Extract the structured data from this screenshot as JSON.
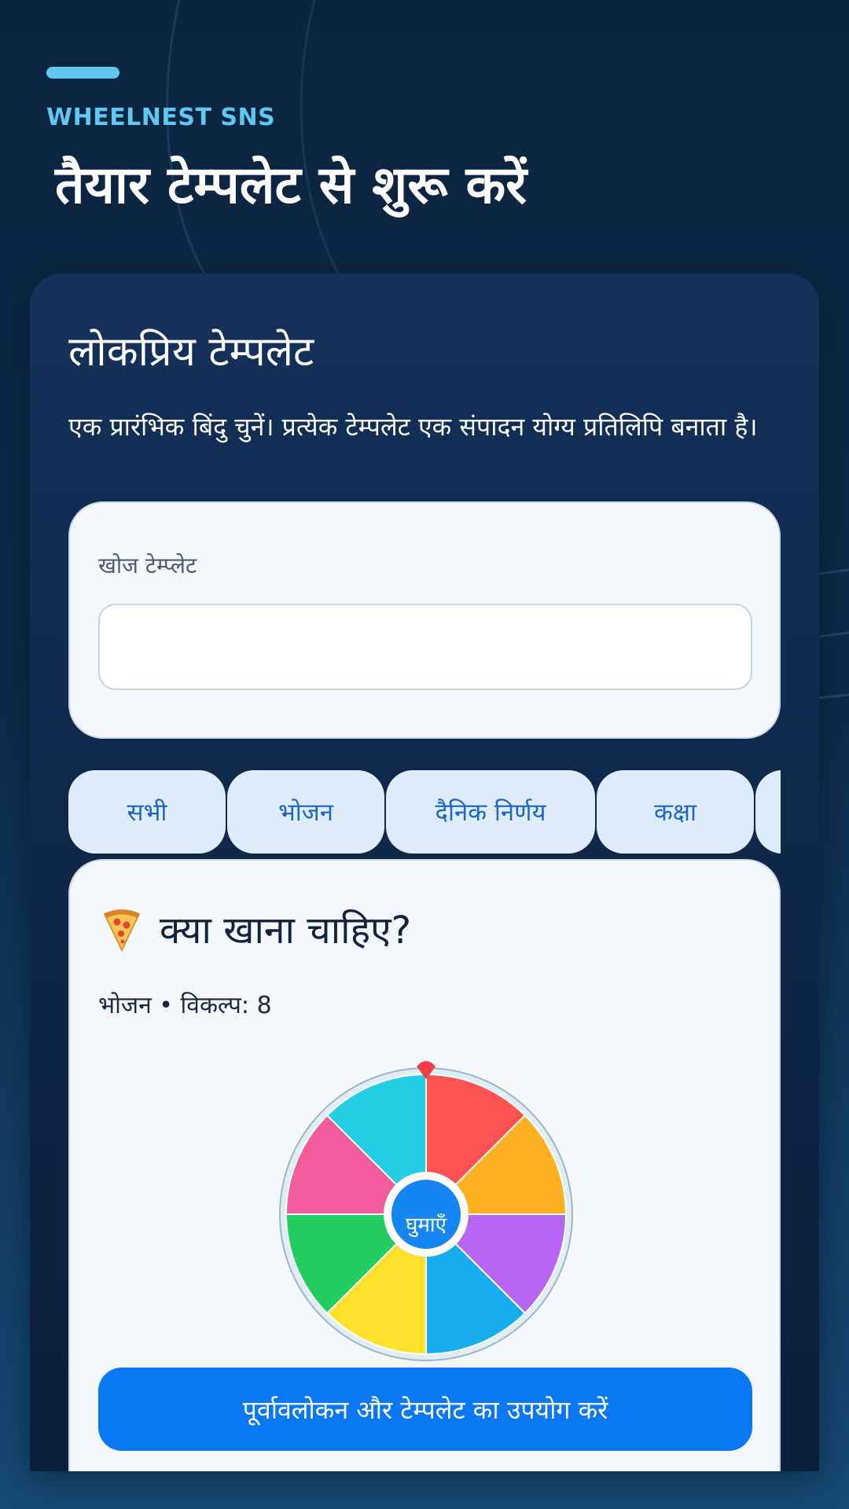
{
  "header": {
    "brand": "WHEELNEST SNS",
    "title": "तैयार टेम्पलेट से शुरू करें"
  },
  "panel": {
    "title": "लोकप्रिय टेम्पलेट",
    "description": "एक प्रारंभिक बिंदु चुनें। प्रत्येक टेम्पलेट एक संपादन योग्य प्रतिलिपि बनाता है।"
  },
  "search": {
    "label": "खोज टेम्प्लेट",
    "value": "",
    "placeholder": ""
  },
  "categories": [
    {
      "label": "सभी"
    },
    {
      "label": "भोजन"
    },
    {
      "label": "दैनिक निर्णय"
    },
    {
      "label": "कक्षा"
    },
    {
      "label": ""
    }
  ],
  "template": {
    "icon": "pizza-icon",
    "title": "क्या खाना चाहिए?",
    "meta": "भोजन • विकल्प: 8",
    "spin_label": "घुमाएँ",
    "wheel_colors": [
      "#ff5252",
      "#ffb020",
      "#b765f2",
      "#17aef0",
      "#ffe02a",
      "#23cc5f",
      "#f25c9c",
      "#22cfe2"
    ],
    "cta_label": "पूर्वावलोकन और टेम्पलेट का उपयोग करें"
  },
  "colors": {
    "accent": "#5ec8f2",
    "primary_button": "#0a78f5",
    "chip_bg": "#ddebfa",
    "chip_text": "#1b66c8"
  }
}
